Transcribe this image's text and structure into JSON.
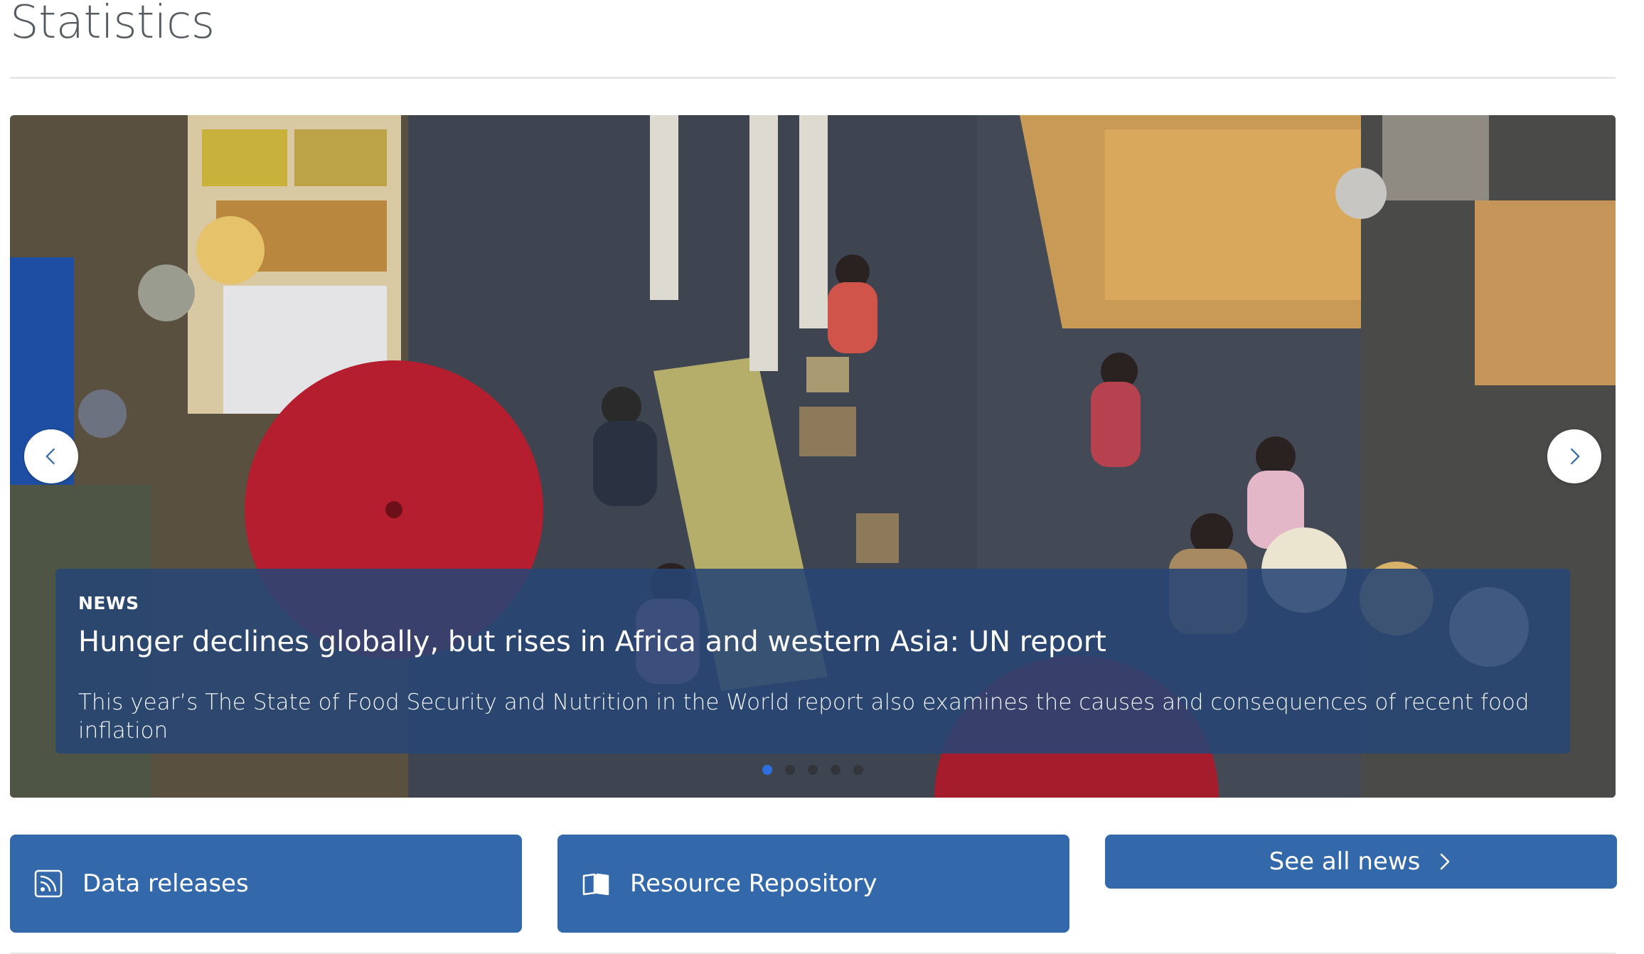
{
  "page": {
    "title": "Statistics"
  },
  "carousel": {
    "slide": {
      "category": "NEWS",
      "headline": "Hunger declines globally, but rises in Africa and western Asia: UN report",
      "summary": "This year’s The State of Food Security and Nutrition in the World report also examines the causes and consequences of recent food inflation"
    },
    "slide_count": 5,
    "active_index": 0,
    "prev_icon": "chevron-left-icon",
    "next_icon": "chevron-right-icon"
  },
  "actions": {
    "data_releases": {
      "label": "Data releases",
      "icon": "rss-feed-icon"
    },
    "resource_repository": {
      "label": "Resource Repository",
      "icon": "open-book-icon"
    },
    "see_all_news": {
      "label": "See all news",
      "icon": "chevron-right-icon"
    }
  },
  "colors": {
    "button_blue": "#3369aa",
    "caption_bg": "#274674",
    "active_dot": "#2f6fe0",
    "title_text": "#555b61"
  }
}
